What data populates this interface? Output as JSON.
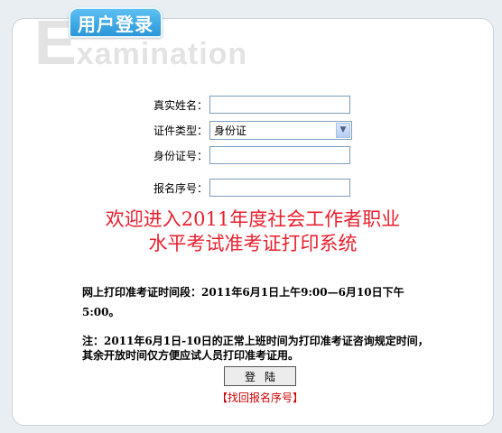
{
  "header": {
    "tab_title": "用户登录",
    "bg_letter": "E",
    "bg_word": "xamination"
  },
  "form": {
    "real_name_label": "真实姓名：",
    "real_name_value": "",
    "id_type_label": "证件类型：",
    "id_type_selected": "身份证",
    "id_number_label": "身份证号：",
    "id_number_value": "",
    "reg_number_label": "报名序号：",
    "reg_number_value": ""
  },
  "welcome": {
    "line1": "欢迎进入2011年度社会工作者职业",
    "line2": "水平考试准考证打印系统"
  },
  "notice": {
    "print_period": "网上打印准考证时间段：2011年6月1日上午9:00—6月10日下午5:00。",
    "note": "注：2011年6月1日-10日的正常上班时间为打印准考证咨询规定时间，其余开放时间仅方便应试人员打印准考证用。"
  },
  "actions": {
    "login_label": "登陆",
    "retrieve_link": "【找回报名序号】"
  },
  "colors": {
    "tab_blue": "#2b97d8",
    "welcome_red": "#e8202f",
    "link_red": "#cc0000"
  }
}
